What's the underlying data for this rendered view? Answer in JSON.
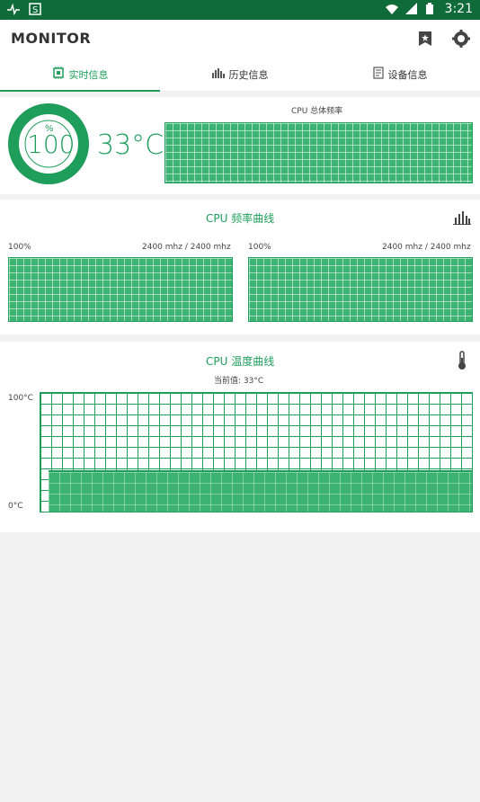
{
  "statusbar": {
    "time": "3:21",
    "left_icons": [
      "pulse-icon",
      "app-s-icon"
    ],
    "right_icons": [
      "wifi-icon",
      "signal-icon",
      "battery-icon"
    ]
  },
  "app": {
    "title": "MONITOR",
    "actions": [
      "bookmark-icon",
      "settings-icon"
    ]
  },
  "tabs": [
    {
      "label": "实时信息",
      "icon": "chip-icon",
      "active": true
    },
    {
      "label": "历史信息",
      "icon": "bar-chart-icon",
      "active": false
    },
    {
      "label": "设备信息",
      "icon": "document-icon",
      "active": false
    }
  ],
  "cpu_overview": {
    "usage_unit": "%",
    "usage_value": "100",
    "usage_fraction": 1.0,
    "temperature": "33°C",
    "freq_chart_title": "CPU 总体频率"
  },
  "freq_curves": {
    "title": "CPU 频率曲线",
    "cores": [
      {
        "percent": "100%",
        "freq": "2400 mhz / 2400 mhz"
      },
      {
        "percent": "100%",
        "freq": "2400 mhz / 2400 mhz"
      }
    ]
  },
  "temp_curve": {
    "title": "CPU 温度曲线",
    "current": "当前值: 33°C",
    "ymax_label": "100°C",
    "ymin_label": "0°C",
    "current_value": 33
  },
  "colors": {
    "accent": "#1e9e5a",
    "statusbar": "#0f6b3a",
    "fill": "#3cb371"
  }
}
